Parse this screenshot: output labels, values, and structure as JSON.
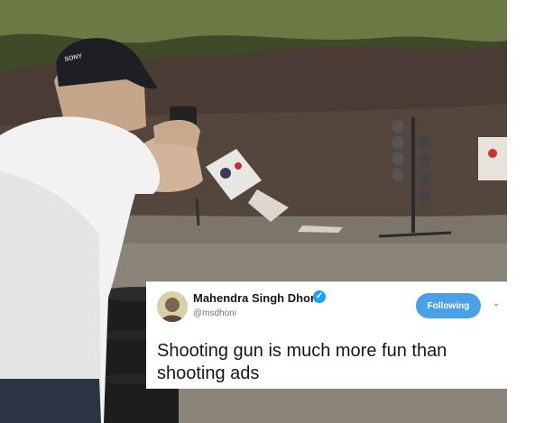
{
  "tweet": {
    "display_name": "Mahendra Singh Dhoni",
    "handle": "@msdhoni",
    "verified_icon": "verified-badge-icon",
    "follow_label": "Following",
    "menu_icon": "chevron-down-icon",
    "text": "Shooting gun is much more fun than shooting ads"
  },
  "photo": {
    "cap_text": "SONY",
    "scene": [
      "grass-hill",
      "dirt-berm",
      "shooter",
      "paper-targets",
      "steel-plate-rack",
      "tire-barrier"
    ]
  },
  "colors": {
    "follow_button": "#4ba0e8",
    "verified": "#1da1f2",
    "tweet_text": "#14171a",
    "handle_text": "#657786"
  }
}
